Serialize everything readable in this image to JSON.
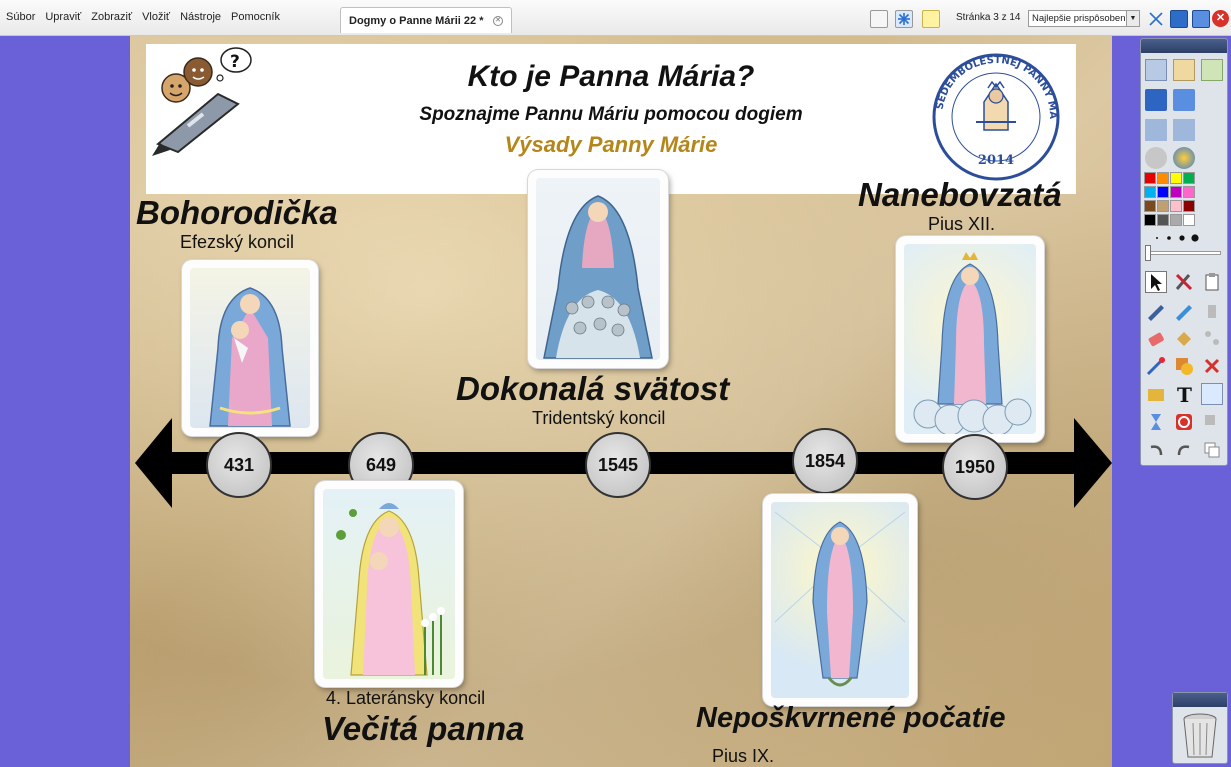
{
  "menubar": {
    "menus": [
      "Súbor",
      "Upraviť",
      "Zobraziť",
      "Vložiť",
      "Nástroje",
      "Pomocník"
    ],
    "doc_tab": "Dogmy o Panne Márii 22 *",
    "page_indicator": "Stránka 3 z 14",
    "zoom_value": "Najlepšie prispôsobenie"
  },
  "slide": {
    "title": "Kto je Panna Mária?",
    "subtitle": "Spoznajme Pannu Máriu pomocou dogiem",
    "subtitle2": "Výsady Panny Márie",
    "seal": {
      "ring_text": "ROK SEDEMBOLESTNEJ PANNY MÁRIE",
      "year": "2014"
    },
    "events": [
      {
        "title": "Bohorodička",
        "council": "Efezský koncil",
        "year": "431"
      },
      {
        "title": "Večitá panna",
        "council": "4. Lateránsky koncil",
        "year": "649"
      },
      {
        "title": "Dokonalá svätost",
        "council": "Tridentský koncil",
        "year": "1545"
      },
      {
        "title": "Nepoškvrnené počatie",
        "council": "Pius IX.",
        "year": "1854"
      },
      {
        "title": "Nanebovzatá",
        "council": "Pius XII.",
        "year": "1950"
      }
    ],
    "timeline_color": "#000000"
  },
  "tool_panel": {
    "palette": [
      "#e60000",
      "#ff8c00",
      "#ffff00",
      "#00b050",
      "#00b0f0",
      "#0000ff",
      "#c000c0",
      "#ff66cc",
      "#7a4a1e",
      "#c0a070",
      "#ffc0cb",
      "#8b0000",
      "#000000",
      "#555555",
      "#aaaaaa",
      "#ffffff"
    ]
  },
  "icons": [
    "toolbar-icon",
    "snowflake-icon",
    "note-icon",
    "close-icon",
    "trash-icon",
    "pen-icon",
    "eraser-icon",
    "text-icon"
  ]
}
